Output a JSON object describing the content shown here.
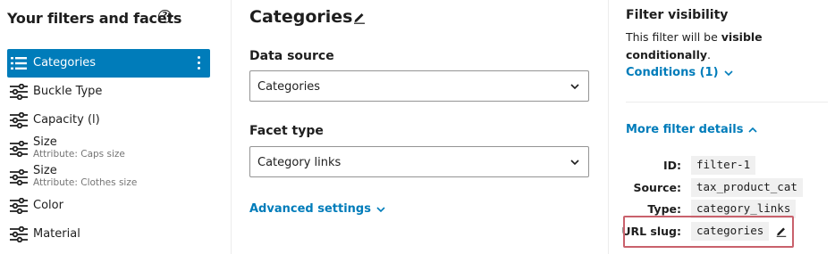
{
  "left": {
    "title": "Your filters and facets",
    "help_icon": "?",
    "facets": [
      {
        "label": "Categories",
        "sub": "",
        "icon": "list-icon",
        "active": true
      },
      {
        "label": "Buckle Type",
        "sub": "",
        "icon": "sliders-icon"
      },
      {
        "label": "Capacity (l)",
        "sub": "",
        "icon": "sliders-icon"
      },
      {
        "label": "Size",
        "sub": "Attribute: Caps size",
        "icon": "sliders-icon"
      },
      {
        "label": "Size",
        "sub": "Attribute: Clothes size",
        "icon": "sliders-icon"
      },
      {
        "label": "Color",
        "sub": "",
        "icon": "sliders-icon"
      },
      {
        "label": "Material",
        "sub": "",
        "icon": "sliders-icon"
      }
    ]
  },
  "main": {
    "title": "Categories",
    "data_source_label": "Data source",
    "data_source_value": "Categories",
    "facet_type_label": "Facet type",
    "facet_type_value": "Category links",
    "advanced_settings": "Advanced settings"
  },
  "right": {
    "visibility_title": "Filter visibility",
    "visibility_text_1": "This filter will be ",
    "visibility_text_bold": "visible conditionally",
    "visibility_text_2": ".",
    "conditions_link": "Conditions (1)",
    "more_details_link": "More filter details",
    "details": [
      {
        "key": "ID:",
        "value": "filter-1"
      },
      {
        "key": "Source:",
        "value": "tax_product_cat"
      },
      {
        "key": "Type:",
        "value": "category_links"
      },
      {
        "key": "URL slug:",
        "value": "categories"
      }
    ]
  },
  "colors": {
    "accent": "#007cba",
    "highlight_border": "#c9616c",
    "code_bg": "#f0f0f0"
  }
}
